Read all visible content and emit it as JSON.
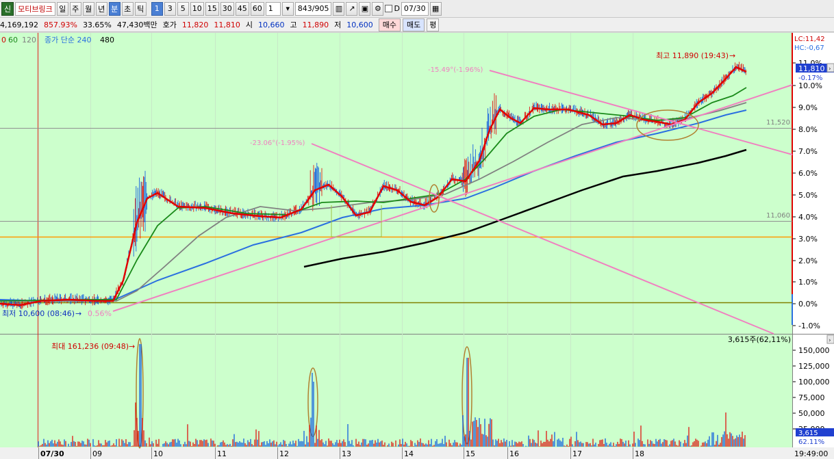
{
  "toolbar": {
    "badge": "신",
    "stock_name": "모티브링크",
    "period_buttons": [
      "일",
      "주",
      "월",
      "년",
      "분",
      "초",
      "틱"
    ],
    "active_period": "분",
    "interval_buttons": [
      "1",
      "3",
      "5",
      "10",
      "15",
      "30",
      "45",
      "60"
    ],
    "active_interval": "1",
    "interval_value": "1",
    "count": "843",
    "total": "/905",
    "date_check_label": "D",
    "date": "07/30"
  },
  "info": {
    "volume": "4,169,192",
    "volume_ratio": "857.93%",
    "turnover_ratio": "33.65%",
    "amount": "47,430백만",
    "quote_label": "호가",
    "ask": "11,820",
    "bid": "11,810",
    "open_label": "시",
    "open": "10,660",
    "high_label": "고",
    "high": "11,890",
    "low_label": "저",
    "low": "10,600",
    "buy_button": "매수",
    "sell_button": "매도",
    "eval_button": "평"
  },
  "chart": {
    "legend_prefix": "0",
    "legend_ma60": "60",
    "legend_ma120": "120",
    "legend_text": "종가 단순 240",
    "legend_ma480": "480",
    "lc_label": "LC:11,42",
    "hc_label": "HC:-0,67",
    "current_price": "11,810",
    "current_pct": "-0.17%",
    "price_levels": [
      "11.0%",
      "10.0%",
      "9.0%",
      "8.0%",
      "7.0%",
      "6.0%",
      "5.0%",
      "4.0%",
      "3.0%",
      "2.0%",
      "1.0%",
      "0.0%",
      "-1.0%"
    ],
    "level_11520": "11,520",
    "level_11060": "11,060",
    "high_annotation": "최고 11,890 (19:43)",
    "low_annotation": "최저 10,600 (08:46)",
    "low_pct": "0.56%",
    "trend_label_1": "-23.06°(-1.95%)",
    "trend_label_2": "-15.49°(-1.96%)"
  },
  "volume": {
    "max_annotation": "최대 161,236 (09:48)",
    "current_annotation": "3,615주(62,11%)",
    "current_volume": "3,615",
    "current_ratio": "62.11%",
    "levels": [
      "150,000",
      "125,000",
      "100,000",
      "75,000",
      "50,000",
      "25,000"
    ]
  },
  "time_axis": {
    "labels": [
      "07/30",
      "09",
      "10",
      "11",
      "12",
      "13",
      "14",
      "15",
      "16",
      "17",
      "18"
    ],
    "current_time": "19:49:00"
  },
  "colors": {
    "chart_bg": "#ccffcc",
    "ma_red": "#e00000",
    "ma_green": "#1a8a1a",
    "ma_gray": "#808080",
    "ma_blue": "#2a6fe0",
    "ma_black": "#000000",
    "trend_pink": "#f080c0",
    "hline_orange": "#ff9900"
  }
}
